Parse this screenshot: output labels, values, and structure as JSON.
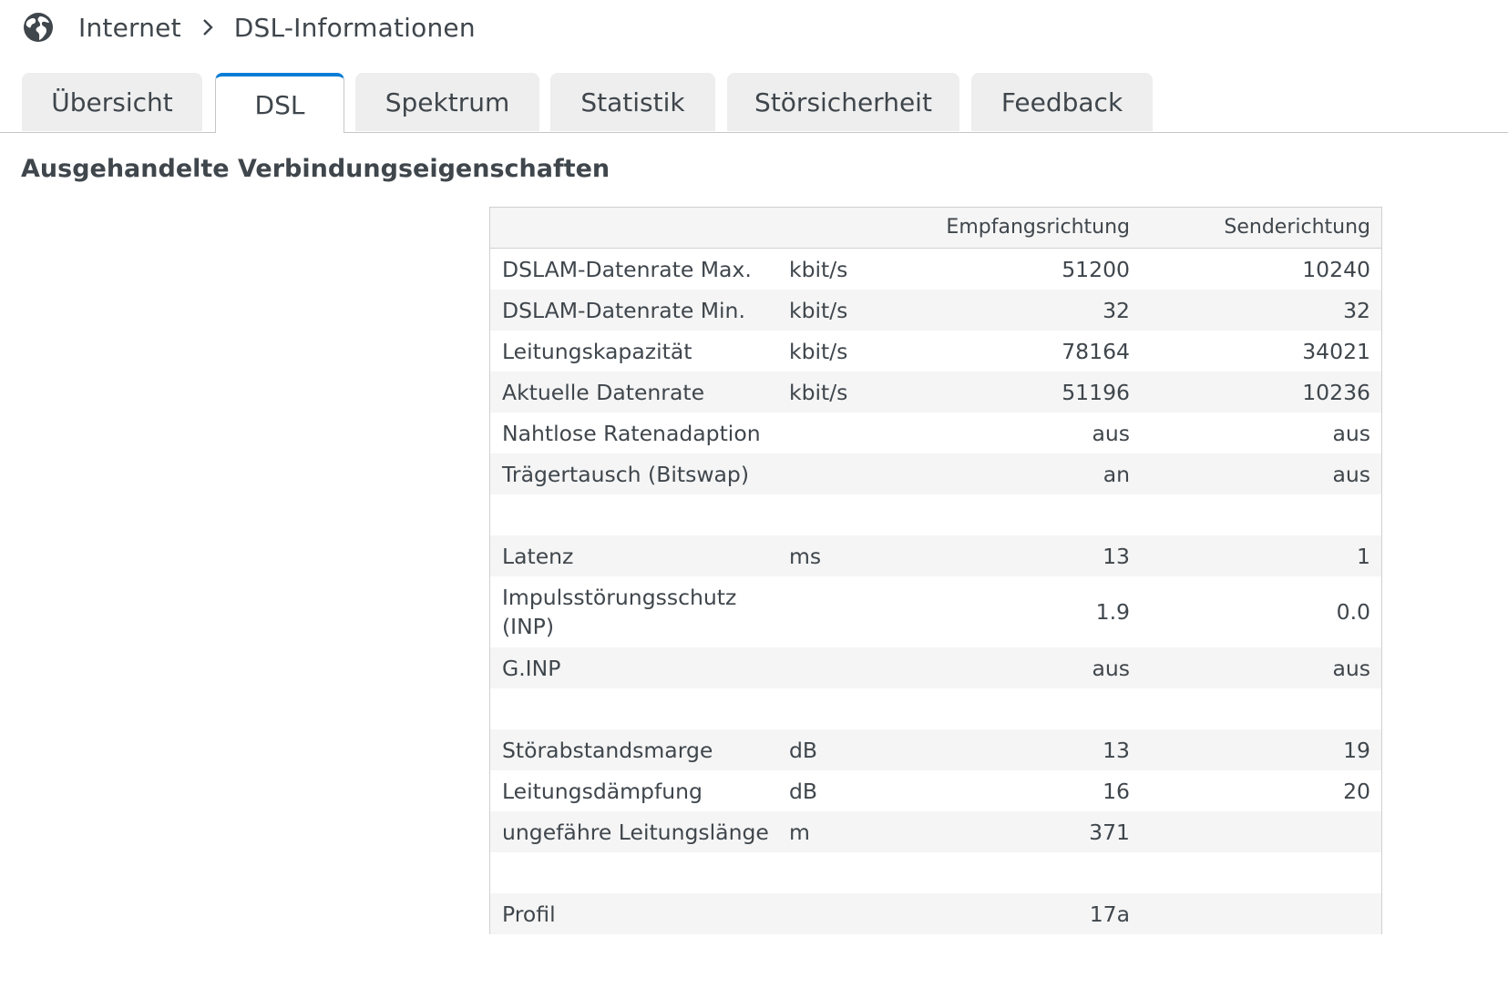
{
  "breadcrumb": {
    "icon": "globe-icon",
    "items": [
      "Internet",
      "DSL-Informationen"
    ]
  },
  "tabs": [
    {
      "label": "Übersicht",
      "active": false
    },
    {
      "label": "DSL",
      "active": true
    },
    {
      "label": "Spektrum",
      "active": false
    },
    {
      "label": "Statistik",
      "active": false
    },
    {
      "label": "Störsicherheit",
      "active": false
    },
    {
      "label": "Feedback",
      "active": false
    }
  ],
  "colors": {
    "accent": "#0a7dd6",
    "row_alt": "#f5f5f5"
  },
  "section": {
    "title": "Ausgehandelte Verbindungseigenschaften"
  },
  "table": {
    "headers": {
      "empfang": "Empfangsrichtung",
      "sende": "Senderichtung"
    },
    "rows": [
      {
        "label": "DSLAM-Datenrate Max.",
        "unit": "kbit/s",
        "empfang": "51200",
        "sende": "10240"
      },
      {
        "label": "DSLAM-Datenrate Min.",
        "unit": "kbit/s",
        "empfang": "32",
        "sende": "32"
      },
      {
        "label": "Leitungskapazität",
        "unit": "kbit/s",
        "empfang": "78164",
        "sende": "34021"
      },
      {
        "label": "Aktuelle Datenrate",
        "unit": "kbit/s",
        "empfang": "51196",
        "sende": "10236"
      },
      {
        "label": "Nahtlose Ratenadaption",
        "unit": "",
        "empfang": "aus",
        "sende": "aus"
      },
      {
        "label": "Trägertausch (Bitswap)",
        "unit": "",
        "empfang": "an",
        "sende": "aus"
      },
      {
        "label": "",
        "unit": "",
        "empfang": "",
        "sende": ""
      },
      {
        "label": "Latenz",
        "unit": "ms",
        "empfang": "13",
        "sende": "1"
      },
      {
        "label": "Impulsstörungsschutz (INP)",
        "unit": "",
        "empfang": "1.9",
        "sende": "0.0"
      },
      {
        "label": "G.INP",
        "unit": "",
        "empfang": "aus",
        "sende": "aus"
      },
      {
        "label": "",
        "unit": "",
        "empfang": "",
        "sende": ""
      },
      {
        "label": "Störabstandsmarge",
        "unit": "dB",
        "empfang": "13",
        "sende": "19"
      },
      {
        "label": "Leitungsdämpfung",
        "unit": "dB",
        "empfang": "16",
        "sende": "20"
      },
      {
        "label": "ungefähre Leitungslänge",
        "unit": "m",
        "empfang": "371",
        "sende": ""
      },
      {
        "label": "",
        "unit": "",
        "empfang": "",
        "sende": ""
      },
      {
        "label": "Profil",
        "unit": "",
        "empfang": "17a",
        "sende": ""
      }
    ]
  }
}
